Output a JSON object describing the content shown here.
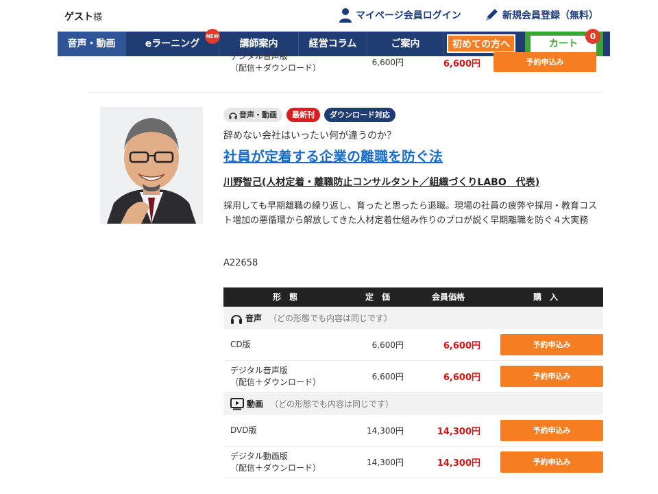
{
  "header": {
    "guest_name": "ゲスト",
    "guest_suffix": "様",
    "mypage_login": "マイページ会員ログイン",
    "register": "新規会員登録（無料）"
  },
  "nav": {
    "items": [
      {
        "label": "音声・動画"
      },
      {
        "label": "eラーニング",
        "badge": "NEW"
      },
      {
        "label": "講師案内"
      },
      {
        "label": "経営コラム"
      },
      {
        "label": "ご案内"
      }
    ],
    "first_time": "初めての方へ",
    "cart": "カート",
    "cart_count": "0"
  },
  "previous_row": {
    "form_line1": "デジタル音声版",
    "form_line2": "（配信＋ダウンロード）",
    "price": "6,600円",
    "member_price": "6,600円",
    "button": "予約申込み"
  },
  "product": {
    "tags": [
      "音声・動画",
      "最新刊",
      "ダウンロード対応"
    ],
    "catch": "辞めない会社はいったい何が違うのか？",
    "title": "社員が定着する企業の離職を防ぐ法",
    "author": "川野智己(人材定着・離職防止コンサルタント／組織づくりLABO　代表)",
    "description": "採用しても早期離職の繰り返し、育ったと思ったら退職。現場の社員の疲弊や採用・教育コスト増加の悪循環から解放してきた人材定着仕組み作りのプロが説く早期離職を防ぐ４大実務",
    "code": "A22658"
  },
  "table": {
    "headers": [
      "形　態",
      "定　価",
      "会員価格",
      "購　入"
    ],
    "sections": [
      {
        "name": "音声",
        "note": "（どの形態でも内容は同じです）",
        "rows": [
          {
            "form1": "CD版",
            "form2": "",
            "price": "6,600円",
            "member_price": "6,600円",
            "button": "予約申込み"
          },
          {
            "form1": "デジタル音声版",
            "form2": "（配信＋ダウンロード）",
            "price": "6,600円",
            "member_price": "6,600円",
            "button": "予約申込み"
          }
        ]
      },
      {
        "name": "動画",
        "note": "（どの形態でも内容は同じです）",
        "rows": [
          {
            "form1": "DVD版",
            "form2": "",
            "price": "14,300円",
            "member_price": "14,300円",
            "button": "予約申込み"
          },
          {
            "form1": "デジタル動画版",
            "form2": "（配信＋ダウンロード）",
            "price": "14,300円",
            "member_price": "14,300円",
            "button": "予約申込み"
          }
        ]
      }
    ]
  },
  "colors": {
    "nav_bg": "#1f3c73",
    "accent_orange": "#f57e23",
    "cart_green": "#3aa535",
    "price_red": "#d01515",
    "title_blue": "#1a6cc7"
  }
}
